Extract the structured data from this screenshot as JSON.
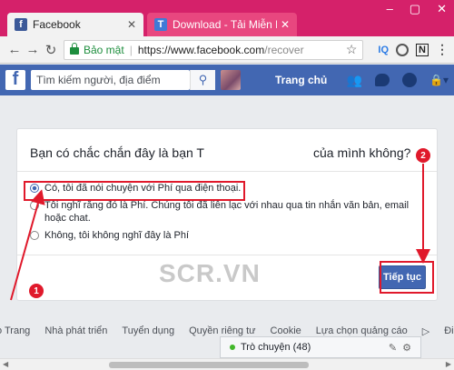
{
  "browser": {
    "tabs": [
      {
        "title": "Facebook",
        "favicon": "f"
      },
      {
        "title": "Download - Tải Miễn Phí",
        "favicon": "T"
      }
    ],
    "secure_label": "Bảo mật",
    "url_host": "https://www.facebook.com",
    "url_path": "/recover",
    "extensions": [
      "IQ",
      "N"
    ]
  },
  "facebook": {
    "search_placeholder": "Tìm kiếm người, địa điểm",
    "home_label": "Trang chủ"
  },
  "dialog": {
    "title_prefix": "Bạn có chắc chắn đây là bạn T",
    "title_suffix": "của mình không?",
    "options": [
      {
        "label": "Có, tôi đã nói chuyện với Phí qua điện thoại.",
        "checked": true
      },
      {
        "label": "Tôi nghĩ rằng đó là Phí. Chúng tôi đã liên lạc với nhau qua tin nhắn văn bản, email hoặc chat.",
        "checked": false
      },
      {
        "label": "Không, tôi không nghĩ đây là Phí",
        "checked": false
      }
    ],
    "continue_label": "Tiếp tục"
  },
  "annotations": {
    "badge_1": "1",
    "badge_2": "2",
    "watermark": "SCR.VN",
    "color": "#e0192b"
  },
  "footer": {
    "links": [
      "o Trang",
      "Nhà phát triển",
      "Tuyển dụng",
      "Quyền riêng tư",
      "Cookie",
      "Lựa chọn quảng cáo",
      "Điều k"
    ]
  },
  "chat": {
    "label": "Trò chuyện (48)"
  }
}
